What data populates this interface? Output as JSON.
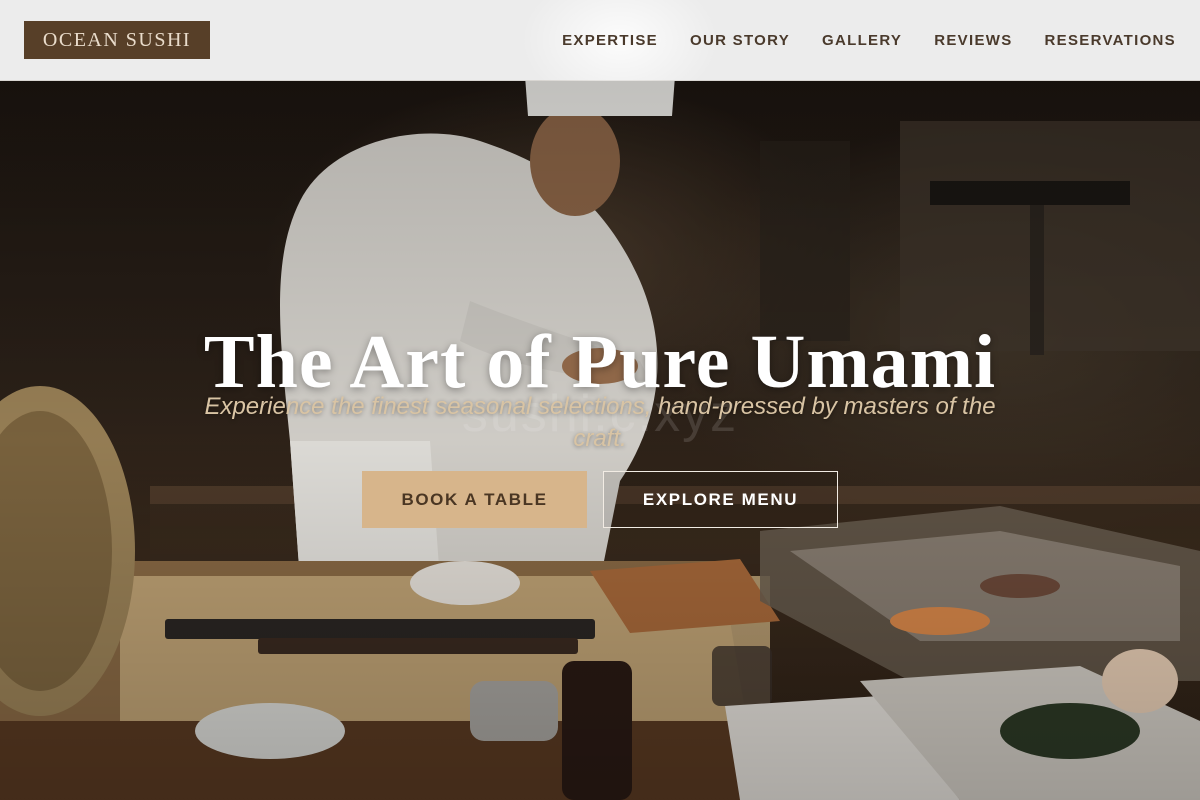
{
  "brand": {
    "name": "OCEAN SUSHI"
  },
  "nav": {
    "items": [
      {
        "label": "EXPERTISE"
      },
      {
        "label": "OUR STORY"
      },
      {
        "label": "GALLERY"
      },
      {
        "label": "REVIEWS"
      },
      {
        "label": "RESERVATIONS"
      }
    ]
  },
  "hero": {
    "title": "The Art of Pure Umami",
    "subtitle": "Experience the finest seasonal selections, hand-pressed by masters of the craft.",
    "watermark": "sushi.c.xyz",
    "buttons": {
      "book": "BOOK A TABLE",
      "menu": "EXPLORE MENU"
    }
  },
  "colors": {
    "brand_brown": "#573f28",
    "accent_tan": "#d7b58b",
    "subtitle_gold": "#d9c4a4",
    "header_bg": "#ececec"
  }
}
